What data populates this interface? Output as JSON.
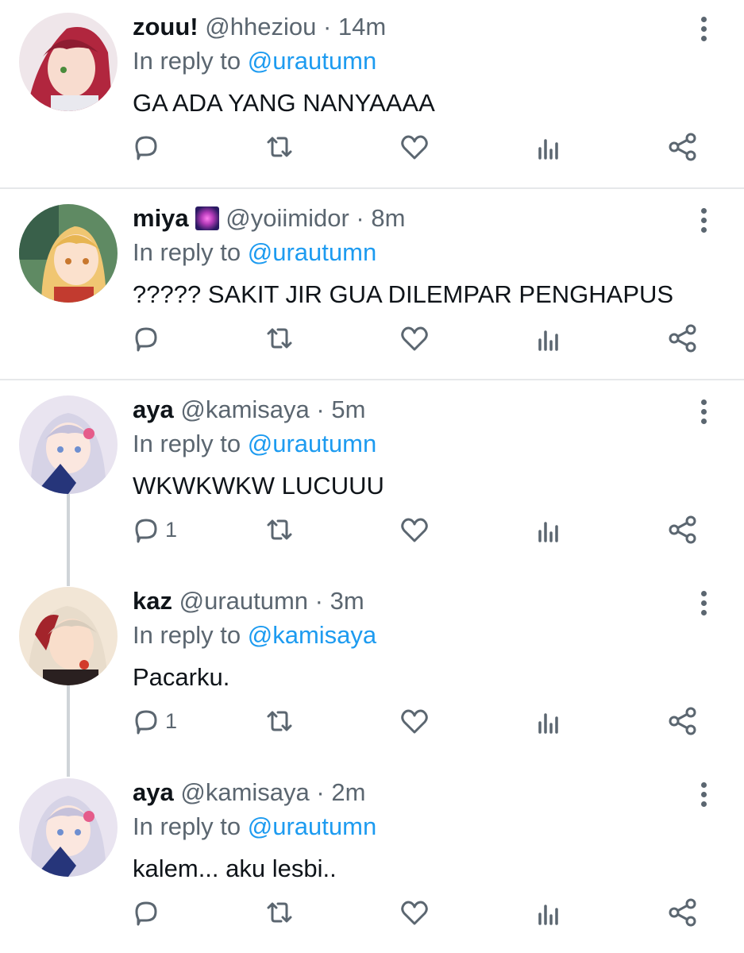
{
  "colors": {
    "mention": "#1d9bf0",
    "secondary": "#5b6670",
    "divider": "#e6e8ea",
    "thread_line": "#cfd4d8"
  },
  "tweets": [
    {
      "name": "zouu!",
      "handle": "@hheziou",
      "dot": "·",
      "time": "14m",
      "reply_prefix": "In reply to",
      "reply_to": "@urautumn",
      "text": "GA ADA YANG NANYAAAA",
      "reply_count": "",
      "avatar_icon": "avatar-red-hair"
    },
    {
      "name": "miya",
      "name_emoji": "sparkle-emoji",
      "handle": "@yoiimidor",
      "dot": "·",
      "time": "8m",
      "reply_prefix": "In reply to",
      "reply_to": "@urautumn",
      "text": "????? SAKIT JIR GUA DILEMPAR PENGHAPUS",
      "reply_count": "",
      "avatar_icon": "avatar-blonde"
    },
    {
      "name": "aya",
      "handle": "@kamisaya",
      "dot": "·",
      "time": "5m",
      "reply_prefix": "In reply to",
      "reply_to": "@urautumn",
      "text": "WKWKWKW LUCUUU",
      "reply_count": "1",
      "avatar_icon": "avatar-white-hair"
    },
    {
      "name": "kaz",
      "handle": "@urautumn",
      "dot": "·",
      "time": "3m",
      "reply_prefix": "In reply to",
      "reply_to": "@kamisaya",
      "text": "Pacarku.",
      "reply_count": "1",
      "avatar_icon": "avatar-silver-red-hair"
    },
    {
      "name": "aya",
      "handle": "@kamisaya",
      "dot": "·",
      "time": "2m",
      "reply_prefix": "In reply to",
      "reply_to": "@urautumn",
      "text": "kalem... aku lesbi..",
      "reply_count": "",
      "avatar_icon": "avatar-white-hair"
    }
  ]
}
